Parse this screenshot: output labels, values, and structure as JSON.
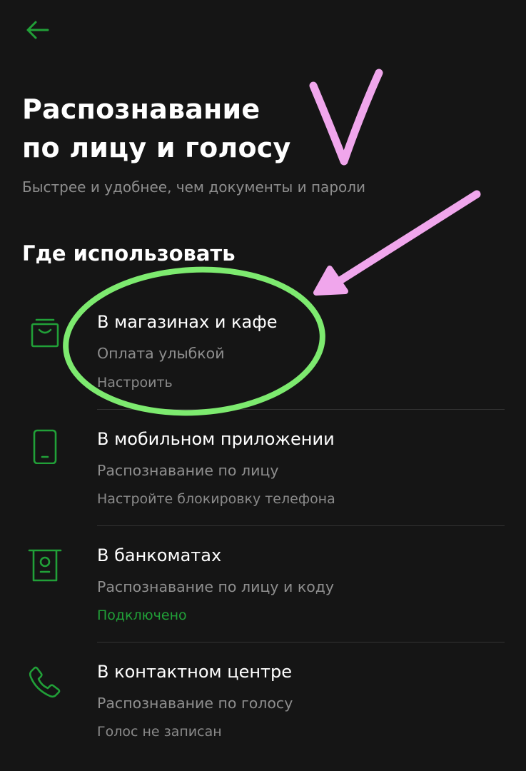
{
  "header": {
    "back_icon": "arrow-left-icon",
    "title_line1": "Распознавание",
    "title_line2": "по лицу и голосу",
    "subtitle": "Быстрее и удобнее, чем документы и пароли"
  },
  "section": {
    "title": "Где использовать"
  },
  "items": [
    {
      "icon": "shopping-bag-icon",
      "label": "В магазинах и кафе",
      "description": "Оплата улыбкой",
      "status": "Настроить",
      "status_state": "default"
    },
    {
      "icon": "smartphone-icon",
      "label": "В мобильном приложении",
      "description": "Распознавание по лицу",
      "status": "Настройте блокировку телефона",
      "status_state": "default"
    },
    {
      "icon": "atm-icon",
      "label": "В банкоматах",
      "description": "Распознавание по лицу и коду",
      "status": "Подключено",
      "status_state": "connected"
    },
    {
      "icon": "phone-icon",
      "label": "В контактном центре",
      "description": "Распознавание по голосу",
      "status": "Голос не записан",
      "status_state": "default"
    }
  ],
  "colors": {
    "background": "#151515",
    "accent_green": "#21a038",
    "text_primary": "#ffffff",
    "text_secondary": "#8e8e8e",
    "annotation_pink": "#f0a6ec",
    "annotation_green": "#7dea6f"
  }
}
